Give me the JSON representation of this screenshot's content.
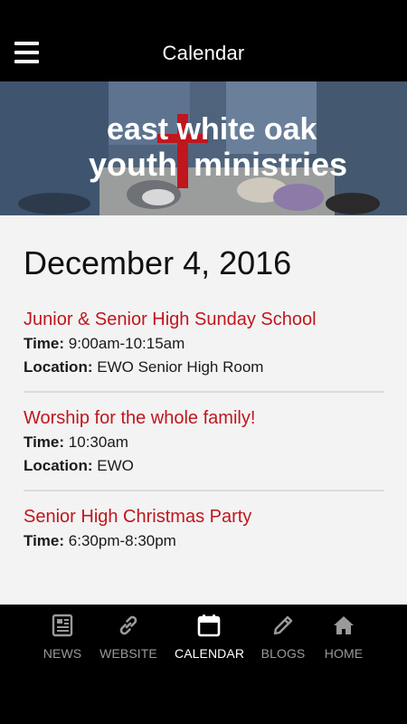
{
  "header": {
    "title": "Calendar"
  },
  "banner": {
    "logo_line1": "east white oak",
    "logo_line2_a": "youth",
    "logo_line2_b": "ministries"
  },
  "calendar": {
    "date": "December 4, 2016",
    "events": [
      {
        "title": "Junior & Senior High Sunday School",
        "time_label": "Time:",
        "time": "9:00am-10:15am",
        "location_label": "Location:",
        "location": "EWO Senior High Room"
      },
      {
        "title": "Worship for the whole family!",
        "time_label": "Time:",
        "time": "10:30am",
        "location_label": "Location:",
        "location": "EWO"
      },
      {
        "title": "Senior High Christmas Party",
        "time_label": "Time:",
        "time": "6:30pm-8:30pm"
      }
    ]
  },
  "tabs": [
    {
      "label": "NEWS",
      "icon": "newspaper-icon",
      "active": false
    },
    {
      "label": "WEBSITE",
      "icon": "link-icon",
      "active": false
    },
    {
      "label": "CALENDAR",
      "icon": "calendar-icon",
      "active": true
    },
    {
      "label": "BLOGS",
      "icon": "pencil-icon",
      "active": false
    },
    {
      "label": "HOME",
      "icon": "home-icon",
      "active": false
    }
  ],
  "colors": {
    "accent": "#c0161e",
    "tab_inactive": "#9a9a9a",
    "tab_active": "#ffffff",
    "background": "#f3f3f3"
  }
}
